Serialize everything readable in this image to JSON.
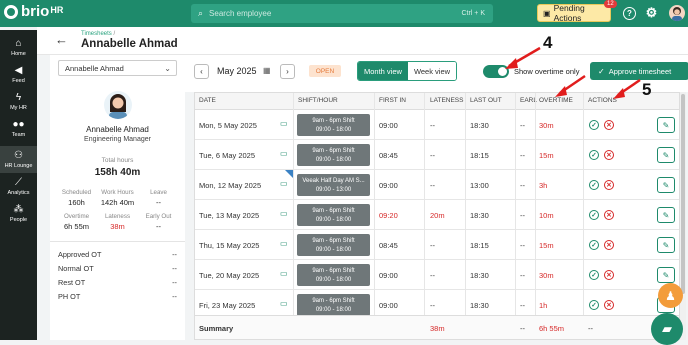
{
  "app": {
    "logo_text": "brio",
    "logo_suffix": "HR",
    "search_placeholder": "Search employee",
    "search_shortcut": "Ctrl + K",
    "pending_label": "Pending Actions",
    "pending_count": "12"
  },
  "sidebar": {
    "items": [
      {
        "label": "Home",
        "icon": "home-icon"
      },
      {
        "label": "Feed",
        "icon": "megaphone-icon"
      },
      {
        "label": "My HR",
        "icon": "bolt-icon"
      },
      {
        "label": "Team",
        "icon": "team-icon"
      },
      {
        "label": "HR Lounge",
        "icon": "lounge-icon"
      },
      {
        "label": "Analytics",
        "icon": "analytics-icon"
      },
      {
        "label": "People",
        "icon": "people-icon"
      }
    ]
  },
  "header": {
    "breadcrumb": "Timesheets",
    "breadcrumb_sep": " /",
    "title": "Annabelle Ahmad"
  },
  "employee": {
    "selected": "Annabelle Ahmad",
    "name": "Annabelle Ahmad",
    "role": "Engineering Manager",
    "total_hours_label": "Total hours",
    "total_hours": "158h 40m",
    "stats": {
      "scheduled_label": "Scheduled",
      "scheduled": "160h",
      "work_hours_label": "Work Hours",
      "work_hours": "142h 40m",
      "leave_label": "Leave",
      "leave": "--",
      "overtime_label": "Overtime",
      "overtime": "6h 55m",
      "lateness_label": "Lateness",
      "lateness": "38m",
      "early_out_label": "Early Out",
      "early_out": "--"
    },
    "ot_rows": [
      {
        "label": "Approved OT",
        "value": "--"
      },
      {
        "label": "Normal OT",
        "value": "--"
      },
      {
        "label": "Rest OT",
        "value": "--"
      },
      {
        "label": "PH OT",
        "value": "--"
      }
    ]
  },
  "toolbar": {
    "prev": "‹",
    "next": "›",
    "month": "May 2025",
    "status": "OPEN",
    "month_view": "Month view",
    "week_view": "Week view",
    "toggle_label": "Show overtime only",
    "toggle_on": true,
    "approve_label": "Approve timesheet"
  },
  "table": {
    "headers": [
      "DATE",
      "SHIFT/HOUR",
      "FIRST IN",
      "LATENESS",
      "LAST OUT",
      "EARL",
      "OVERTIME",
      "ACTIONS"
    ],
    "rows": [
      {
        "date": "Mon, 5 May 2025",
        "shift": "9am - 6pm Shift",
        "hours": "09:00 - 18:00",
        "first_in": "09:00",
        "lateness": "--",
        "last_out": "18:30",
        "early": "--",
        "overtime": "30m",
        "first_in_red": false,
        "lateness_red": false
      },
      {
        "date": "Tue, 6 May 2025",
        "shift": "9am - 6pm Shift",
        "hours": "09:00 - 18:00",
        "first_in": "08:45",
        "lateness": "--",
        "last_out": "18:15",
        "early": "--",
        "overtime": "15m",
        "first_in_red": false,
        "lateness_red": false
      },
      {
        "date": "Mon, 12 May 2025",
        "shift": "Veeak Half Day AM S...",
        "hours": "09:00 - 13:00",
        "first_in": "09:00",
        "lateness": "--",
        "last_out": "13:00",
        "early": "--",
        "overtime": "3h",
        "first_in_red": false,
        "lateness_red": false
      },
      {
        "date": "Tue, 13 May 2025",
        "shift": "9am - 6pm Shift",
        "hours": "09:00 - 18:00",
        "first_in": "09:20",
        "lateness": "20m",
        "last_out": "18:30",
        "early": "--",
        "overtime": "10m",
        "first_in_red": true,
        "lateness_red": true
      },
      {
        "date": "Thu, 15 May 2025",
        "shift": "9am - 6pm Shift",
        "hours": "09:00 - 18:00",
        "first_in": "08:45",
        "lateness": "--",
        "last_out": "18:15",
        "early": "--",
        "overtime": "15m",
        "first_in_red": false,
        "lateness_red": false
      },
      {
        "date": "Tue, 20 May 2025",
        "shift": "9am - 6pm Shift",
        "hours": "09:00 - 18:00",
        "first_in": "09:00",
        "lateness": "--",
        "last_out": "18:30",
        "early": "--",
        "overtime": "30m",
        "first_in_red": false,
        "lateness_red": false
      },
      {
        "date": "Fri, 23 May 2025",
        "shift": "9am - 6pm Shift",
        "hours": "09:00 - 18:00",
        "first_in": "09:00",
        "lateness": "--",
        "last_out": "18:30",
        "early": "--",
        "overtime": "1h",
        "first_in_red": false,
        "lateness_red": false
      }
    ],
    "summary": {
      "label": "Summary",
      "lateness": "38m",
      "early": "--",
      "overtime": "6h 55m",
      "actions": "--"
    }
  },
  "annotations": {
    "a4": "4",
    "a5": "5"
  },
  "colors": {
    "brand": "#1e8a6b",
    "danger": "#d62828",
    "pending": "#fde9a6"
  }
}
